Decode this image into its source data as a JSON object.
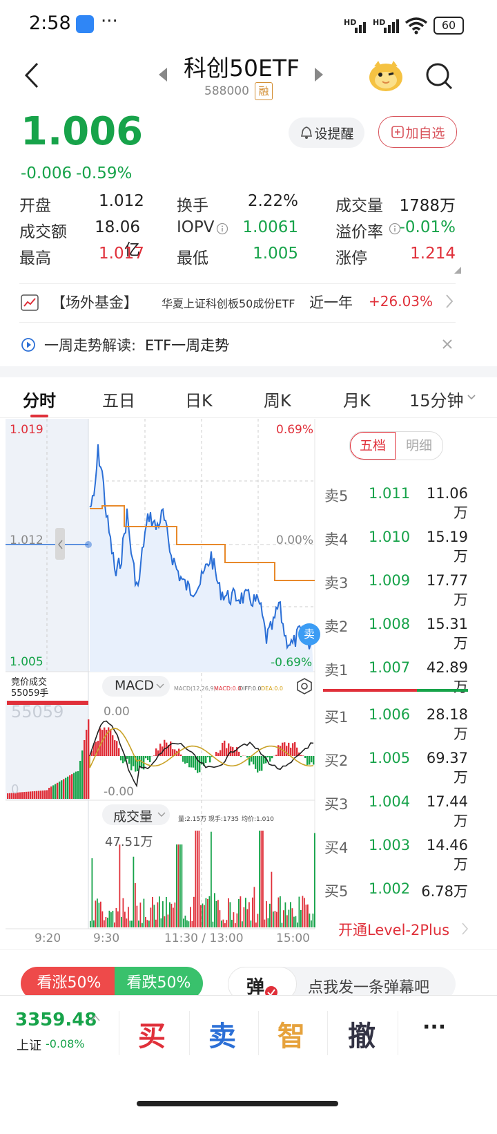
{
  "status": {
    "time": "2:58",
    "dots": "···",
    "net1": "HD",
    "net2": "HD",
    "battery": "60"
  },
  "header": {
    "title": "科创50ETF",
    "code": "588000",
    "rong": "融"
  },
  "quote": {
    "price": "1.006",
    "change": "-0.006",
    "change_pct": "-0.59%",
    "alert": "设提醒",
    "add_fav": "加自选"
  },
  "stats": [
    {
      "label": "开盘",
      "value": "1.012"
    },
    {
      "label": "换手",
      "value": "2.22%"
    },
    {
      "label": "成交量",
      "value": "1788万"
    },
    {
      "label": "成交额",
      "value": "18.06亿"
    },
    {
      "label": "IOPV",
      "value": "1.0061"
    },
    {
      "label": "溢价率",
      "value": "-0.01%"
    },
    {
      "label": "最高",
      "value": "1.017"
    },
    {
      "label": "最低",
      "value": "1.005"
    },
    {
      "label": "涨停",
      "value": "1.214"
    }
  ],
  "fund": {
    "tag": "【场外基金】",
    "name": "华夏上证科创板50成份ETF",
    "period": "近一年",
    "ret": "+26.03%"
  },
  "notice": {
    "prefix": "一周走势解读:",
    "text": "ETF一周走势"
  },
  "tabs": [
    "分时",
    "五日",
    "日K",
    "周K",
    "月K",
    "15分钟"
  ],
  "chart": {
    "ymax": "1.019",
    "ymid": "1.012",
    "ymin": "1.005",
    "pmax": "0.69%",
    "pmid": "0.00%",
    "pmin": "-0.69%",
    "auction_label": "竞价成交",
    "auction_vol": "55059手",
    "auction_big": "55059",
    "auction_zero": "0",
    "macd_label": "MACD",
    "macd_params": "MACD(12,26,9):",
    "macd_v": "MACD:0.0",
    "diff_v": "DIFF:0.0",
    "dea_v": "DEA:0.0",
    "macd_top": "0.00",
    "macd_bot": "-0.00",
    "vol_label": "成交量",
    "vol_info1": "量:2.15万",
    "vol_info2": "现手:1735",
    "vol_info3": "均价:1.010",
    "vol_max": "47.51万",
    "x_labels": [
      "9:20",
      "9:30",
      "11:30 / 13:00",
      "15:00"
    ],
    "sell_badge": "卖"
  },
  "orderbook": {
    "tab1": "五档",
    "tab2": "明细",
    "asks": [
      {
        "label": "卖5",
        "price": "1.011",
        "vol": "11.06万"
      },
      {
        "label": "卖4",
        "price": "1.010",
        "vol": "15.19万"
      },
      {
        "label": "卖3",
        "price": "1.009",
        "vol": "17.77万"
      },
      {
        "label": "卖2",
        "price": "1.008",
        "vol": "15.31万"
      },
      {
        "label": "卖1",
        "price": "1.007",
        "vol": "42.89万"
      }
    ],
    "bids": [
      {
        "label": "买1",
        "price": "1.006",
        "vol": "28.18万"
      },
      {
        "label": "买2",
        "price": "1.005",
        "vol": "69.37万"
      },
      {
        "label": "买3",
        "price": "1.004",
        "vol": "17.44万"
      },
      {
        "label": "买4",
        "price": "1.003",
        "vol": "14.46万"
      },
      {
        "label": "买5",
        "price": "1.002",
        "vol": "6.78万"
      }
    ],
    "level2": "开通Level-2Plus"
  },
  "sentiment": {
    "up": "看涨50%",
    "down": "看跌50%",
    "danmu": "弹",
    "danmu_placeholder": "点我发一条弹幕吧"
  },
  "footer": {
    "index_value": "3359.48",
    "index_name": "上证",
    "index_change": "-0.08%",
    "buy": "买",
    "sell": "卖",
    "smart": "智",
    "cancel": "撤",
    "more": "···"
  },
  "colors": {
    "up": "#e0303a",
    "down": "#17a34a",
    "price_line": "#2b6fd6",
    "avg_line": "#e8892a"
  }
}
